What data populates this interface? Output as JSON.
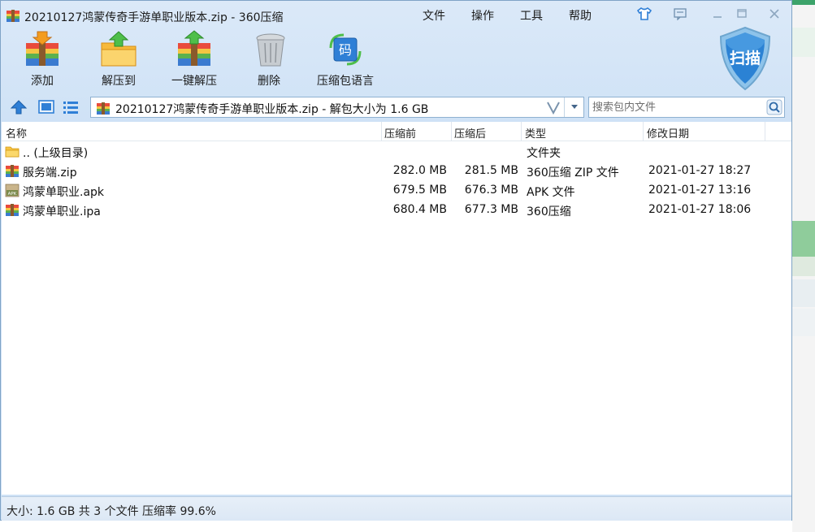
{
  "window": {
    "title": "20210127鸿蒙传奇手游单职业版本.zip - 360压缩"
  },
  "menu": [
    "文件",
    "操作",
    "工具",
    "帮助"
  ],
  "toolbar": {
    "add": "添加",
    "extract_to": "解压到",
    "one_click_extract": "一键解压",
    "delete": "删除",
    "archive_language": "压缩包语言",
    "scan": "扫描"
  },
  "address": {
    "path": "20210127鸿蒙传奇手游单职业版本.zip - 解包大小为 1.6 GB",
    "search_placeholder": "搜索包内文件"
  },
  "list": {
    "columns": [
      "名称",
      "压缩前",
      "压缩后",
      "类型",
      "修改日期"
    ],
    "rows": [
      {
        "name": ".. (上级目录)",
        "before": "",
        "after": "",
        "type": "文件夹",
        "date": "",
        "icon": "folder-icon"
      },
      {
        "name": "服务端.zip",
        "before": "282.0 MB",
        "after": "281.5 MB",
        "type": "360压缩 ZIP 文件",
        "date": "2021-01-27 18:27",
        "icon": "zip-archive-icon"
      },
      {
        "name": "鸿蒙单职业.apk",
        "before": "679.5 MB",
        "after": "676.3 MB",
        "type": "APK 文件",
        "date": "2021-01-27 13:16",
        "icon": "apk-file-icon"
      },
      {
        "name": "鸿蒙单职业.ipa",
        "before": "680.4 MB",
        "after": "677.3 MB",
        "type": "360压缩",
        "date": "2021-01-27 18:06",
        "icon": "zip-archive-icon"
      }
    ]
  },
  "status": {
    "text": "大小: 1.6 GB 共 3 个文件 压缩率 99.6%"
  },
  "colors": {
    "title_bg": "#dbe9f8",
    "accent_blue": "#2f7fd6",
    "border": "#7fa3c6"
  }
}
